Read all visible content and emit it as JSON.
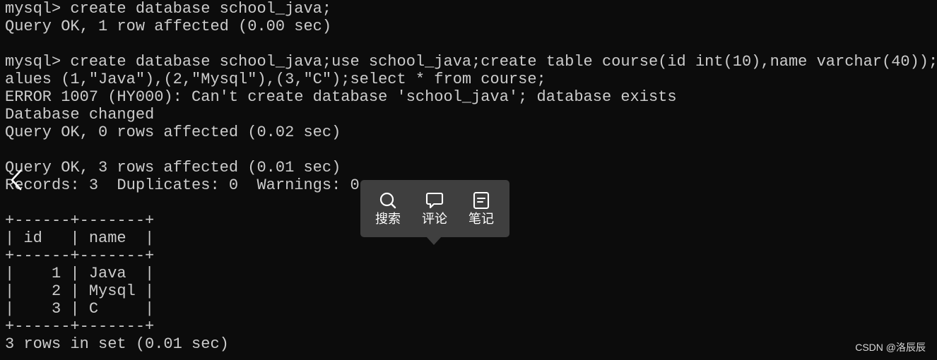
{
  "terminal": {
    "lines": [
      "mysql> create database school_java;",
      "Query OK, 1 row affected (0.00 sec)",
      "",
      "mysql> create database school_java;use school_java;create table course(id int(10),name varchar(40));inser",
      "alues (1,\"Java\"),(2,\"Mysql\"),(3,\"C\");select * from course;",
      "ERROR 1007 (HY000): Can't create database 'school_java'; database exists",
      "Database changed",
      "Query OK, 0 rows affected (0.02 sec)",
      "",
      "Query OK, 3 rows affected (0.01 sec)",
      "Records: 3  Duplicates: 0  Warnings: 0",
      "",
      "+------+-------+",
      "| id   | name  |",
      "+------+-------+",
      "|    1 | Java  |",
      "|    2 | Mysql |",
      "|    3 | C     |",
      "+------+-------+",
      "3 rows in set (0.01 sec)"
    ]
  },
  "toolbar": {
    "search_label": "搜索",
    "search_icon": "search-icon",
    "comment_label": "评论",
    "comment_icon": "comment-icon",
    "note_label": "笔记",
    "note_icon": "note-icon"
  },
  "watermark": {
    "text": "CSDN @洛辰辰"
  },
  "colors": {
    "terminal_bg": "#0c0c0c",
    "terminal_text": "#cccccc",
    "toolbar_bg": "#3f3f3f",
    "toolbar_text": "#ffffff"
  }
}
